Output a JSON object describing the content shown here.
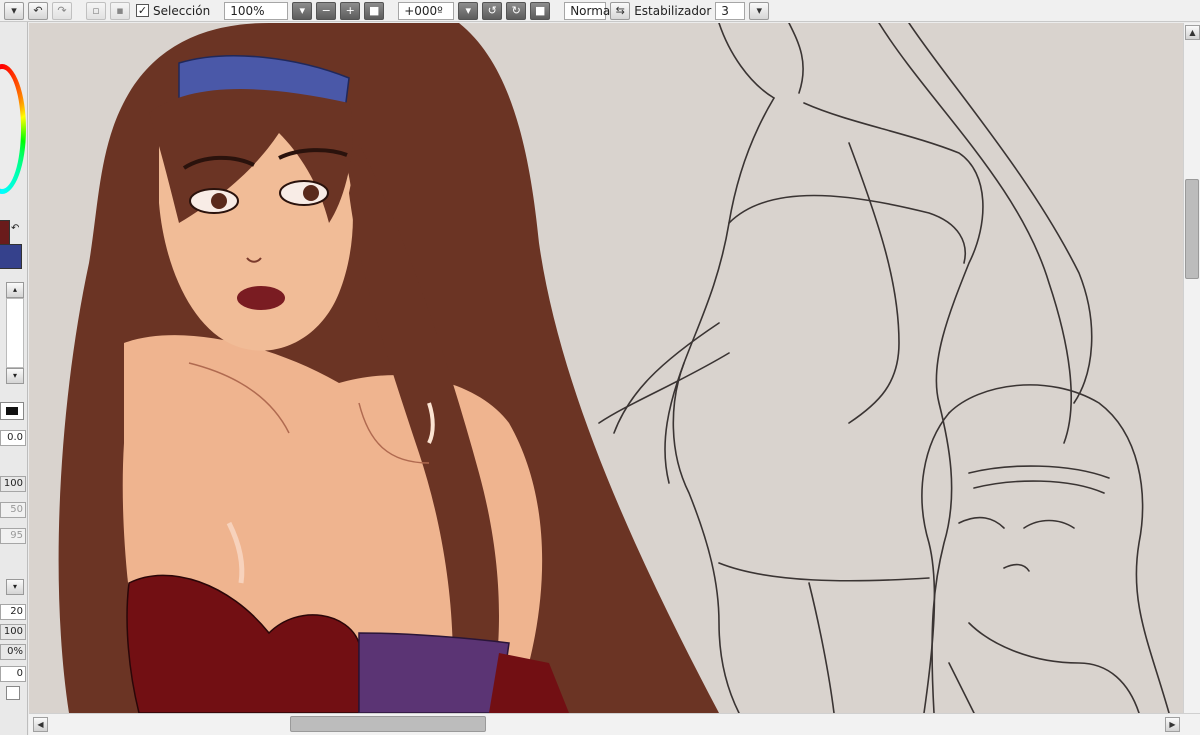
{
  "toolbar": {
    "undo_icon": "undo-icon",
    "redo_icon": "redo-icon",
    "selection_label": "Selección",
    "selection_checked": "✓",
    "zoom_value": "100%",
    "rotation_value": "+000º",
    "blend_mode": "Normal",
    "stabilizer_label": "Estabilizador",
    "stabilizer_value": "3"
  },
  "left_panel": {
    "fields": [
      "0.0",
      "100",
      "50",
      "95",
      "20",
      "100",
      "0%",
      "0"
    ],
    "colors": {
      "foreground": "#6a1b1b",
      "background": "#35418c"
    }
  },
  "canvas": {
    "background": "#d9d3ce",
    "hair_color": "#6b3424",
    "skin_color": "#efb48f",
    "headband_color": "#4a58a8",
    "dress_color": "#720f13",
    "purple_color": "#5b3474"
  }
}
